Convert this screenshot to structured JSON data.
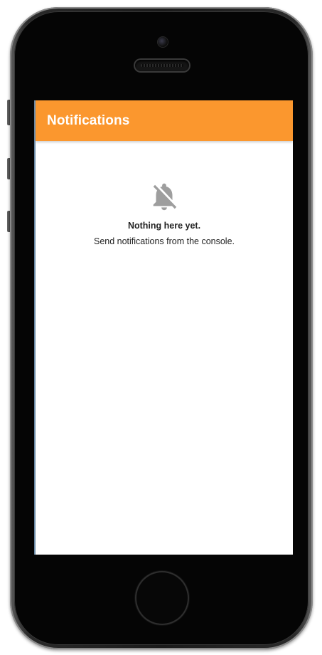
{
  "app_bar": {
    "title": "Notifications",
    "color": "#fb972e"
  },
  "empty_state": {
    "icon": "notifications-off-icon",
    "title": "Nothing here yet.",
    "subtitle": "Send notifications from the console."
  },
  "device": {
    "frame": "phone"
  }
}
